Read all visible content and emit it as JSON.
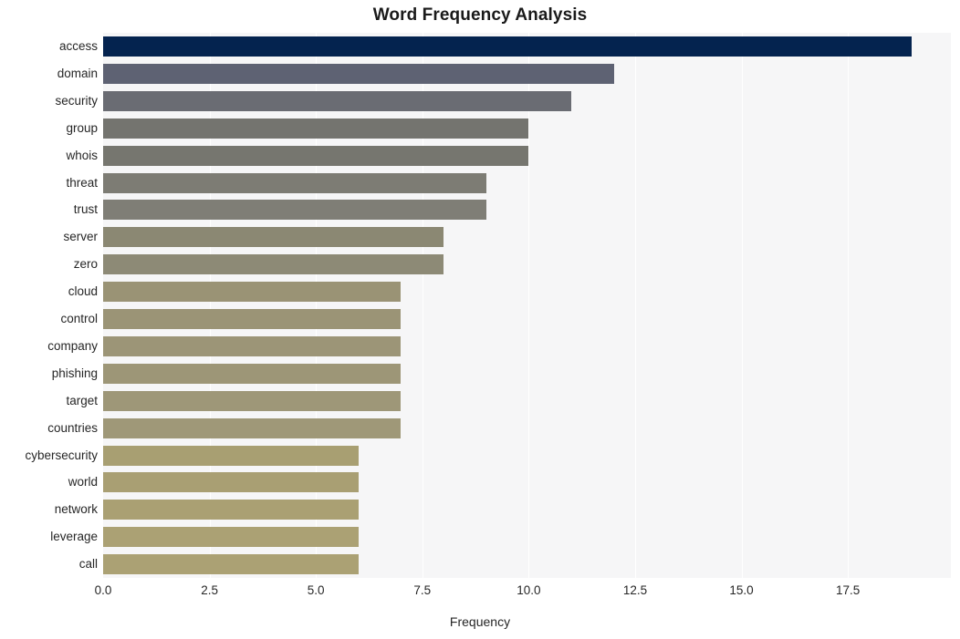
{
  "chart_data": {
    "type": "bar",
    "orientation": "horizontal",
    "title": "Word Frequency Analysis",
    "xlabel": "Frequency",
    "ylabel": "",
    "categories": [
      "access",
      "domain",
      "security",
      "group",
      "whois",
      "threat",
      "trust",
      "server",
      "zero",
      "cloud",
      "control",
      "company",
      "phishing",
      "target",
      "countries",
      "cybersecurity",
      "world",
      "network",
      "leverage",
      "call"
    ],
    "values": [
      19,
      12,
      11,
      10,
      10,
      9,
      9,
      8,
      8,
      7,
      7,
      7,
      7,
      7,
      7,
      6,
      6,
      6,
      6,
      6
    ],
    "xlim": [
      0,
      19.92
    ],
    "xticks": [
      0,
      2.5,
      5,
      7.5,
      10,
      12.5,
      15,
      17.5
    ],
    "xticklabels": [
      "0.0",
      "2.5",
      "5.0",
      "7.5",
      "10.0",
      "12.5",
      "15.0",
      "17.5"
    ],
    "grid": "vertical",
    "legend": "none",
    "bar_colors": [
      "#04234f",
      "#5e6273",
      "#6a6c73",
      "#74746f",
      "#76766f",
      "#7d7c74",
      "#7f7e76",
      "#8b8873",
      "#8d8a76",
      "#9a9375",
      "#9b9476",
      "#9c9577",
      "#9d9677",
      "#9e9778",
      "#9f9878",
      "#a89f72",
      "#a99f73",
      "#aaa073",
      "#aba174",
      "#aba174"
    ]
  },
  "style": {
    "plot_background": "#f6f6f7",
    "figure_background": "#ffffff",
    "gridline_color": "#ffffff",
    "text_color": "#262626"
  }
}
